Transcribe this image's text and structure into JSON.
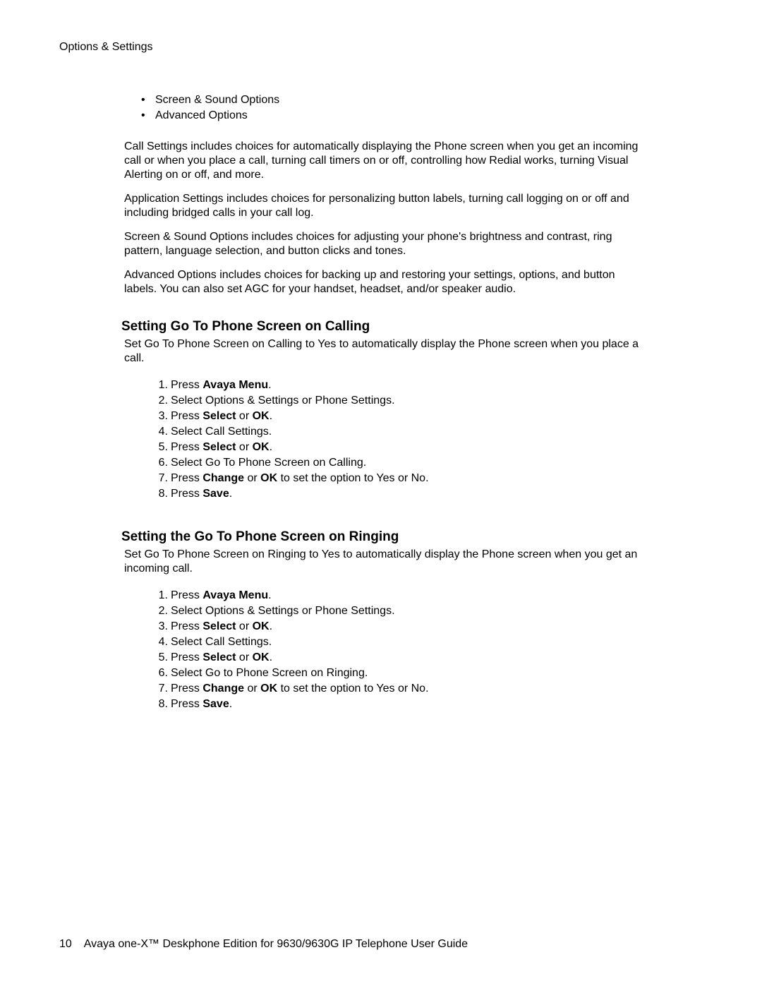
{
  "header": {
    "section": "Options & Settings"
  },
  "intro": {
    "bullets": [
      "Screen & Sound Options",
      "Advanced Options"
    ],
    "paragraphs": [
      "Call Settings includes choices for automatically displaying the Phone screen when you get an incoming call or when you place a call, turning call timers on or off, controlling how Redial works, turning Visual Alerting on or off, and more.",
      "Application Settings includes choices for personalizing button labels, turning call logging on or off and including bridged calls in your call log.",
      "Screen & Sound Options includes choices for adjusting your phone's brightness and contrast, ring pattern, language selection, and button clicks and tones.",
      "Advanced Options includes choices for backing up and restoring your settings, options, and button labels. You can also set AGC for your handset, headset, and/or speaker audio."
    ]
  },
  "section_calling": {
    "title": "Setting Go To Phone Screen on Calling",
    "desc": "Set Go To Phone Screen on Calling to Yes to automatically display the Phone screen when you place a call.",
    "steps": [
      {
        "pre": "Press ",
        "bold1": "Avaya Menu",
        "post": "."
      },
      {
        "pre": "Select Options & Settings or Phone Settings."
      },
      {
        "pre": "Press ",
        "bold1": "Select",
        "mid": " or ",
        "bold2": "OK",
        "post": "."
      },
      {
        "pre": "Select Call Settings."
      },
      {
        "pre": "Press ",
        "bold1": "Select",
        "mid": " or ",
        "bold2": "OK",
        "post": "."
      },
      {
        "pre": "Select Go To Phone Screen on Calling."
      },
      {
        "pre": "Press ",
        "bold1": "Change",
        "mid": " or ",
        "bold2": "OK",
        "post": " to set the option to Yes or No."
      },
      {
        "pre": "Press ",
        "bold1": "Save",
        "post": "."
      }
    ]
  },
  "section_ringing": {
    "title": "Setting the Go To Phone Screen on Ringing",
    "desc": "Set Go To Phone Screen on Ringing to Yes to automatically display the Phone screen when you get an incoming call.",
    "steps": [
      {
        "pre": "Press ",
        "bold1": "Avaya Menu",
        "post": "."
      },
      {
        "pre": "Select Options & Settings or Phone Settings."
      },
      {
        "pre": "Press ",
        "bold1": "Select",
        "mid": " or ",
        "bold2": "OK",
        "post": "."
      },
      {
        "pre": "Select Call Settings."
      },
      {
        "pre": "Press ",
        "bold1": "Select",
        "mid": " or ",
        "bold2": "OK",
        "post": "."
      },
      {
        "pre": "Select Go to Phone Screen on Ringing."
      },
      {
        "pre": "Press ",
        "bold1": "Change",
        "mid": " or ",
        "bold2": "OK",
        "post": " to set the option to Yes or No."
      },
      {
        "pre": "Press ",
        "bold1": "Save",
        "post": "."
      }
    ]
  },
  "footer": {
    "page_number": "10",
    "title": "Avaya one-X™ Deskphone Edition for 9630/9630G IP Telephone User Guide"
  }
}
